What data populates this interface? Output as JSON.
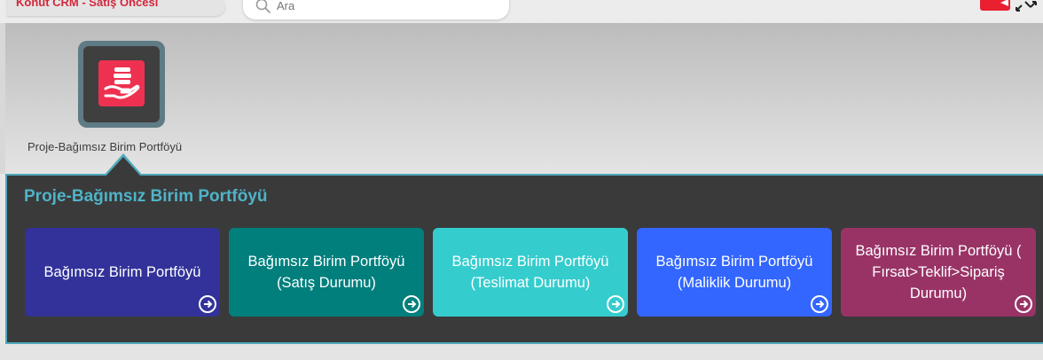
{
  "header": {
    "breadcrumb": "Konut CRM - Satış Öncesi",
    "search_placeholder": "Ara"
  },
  "app": {
    "label": "Proje-Bağımsız Birim Portföyü"
  },
  "panel": {
    "title": "Proje-Bağımsız Birim Portföyü",
    "cards": [
      {
        "label": "Bağımsız Birim Portföyü",
        "color": "#32329a"
      },
      {
        "label": "Bağımsız Birim Portföyü (Satış Durumu)",
        "color": "#007f7d"
      },
      {
        "label": "Bağımsız Birim Portföyü (Teslimat Durumu)",
        "color": "#35cccd"
      },
      {
        "label": "Bağımsız Birim Portföyü (Maliklik Durumu)",
        "color": "#3366ff"
      },
      {
        "label": "Bağımsız Birim Portföyü ( Fırsat>Teklif>Sipariş Durumu)",
        "color": "#993366"
      }
    ]
  },
  "colors": {
    "accent": "#4fa9bd",
    "brand_red": "#d3263b",
    "app_icon": "#ee3150"
  }
}
